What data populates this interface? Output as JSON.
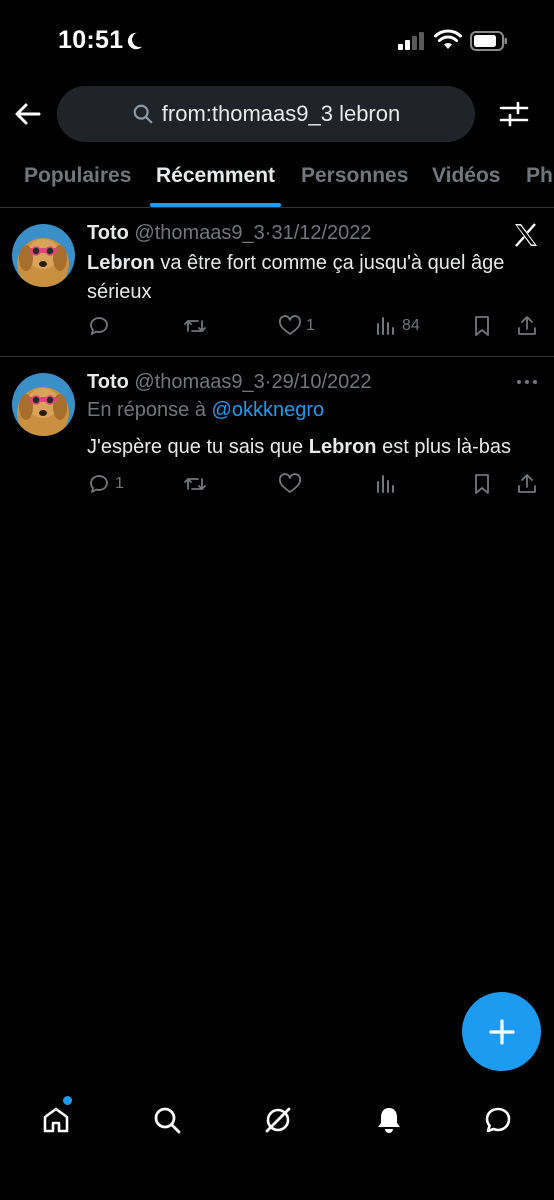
{
  "status_bar": {
    "time": "10:51"
  },
  "search": {
    "query": "from:thomaas9_3 lebron"
  },
  "tabs": [
    {
      "label": "Populaires"
    },
    {
      "label": "Récemment"
    },
    {
      "label": "Personnes"
    },
    {
      "label": "Vidéos"
    },
    {
      "label": "Ph"
    }
  ],
  "tweets": [
    {
      "name": "Toto",
      "handle": "@thomaas9_3",
      "dot": "·",
      "date": "31/12/2022",
      "reply_prefix": "",
      "reply_handle": "",
      "text_bold": "Lebron",
      "text_rest": " va être fort comme ça jusqu'à quel âge sérieux",
      "text_before": "",
      "replies": "",
      "likes": "1",
      "views": "84"
    },
    {
      "name": "Toto",
      "handle": "@thomaas9_3",
      "dot": "·",
      "date": "29/10/2022",
      "reply_prefix": "En réponse à ",
      "reply_handle": "@okkknegro",
      "text_before": "J'espère que tu sais que ",
      "text_bold": "Lebron",
      "text_rest": " est plus là-bas",
      "replies": "1",
      "likes": "",
      "views": ""
    }
  ],
  "colors": {
    "accent": "#1d9bf0",
    "muted": "#71767b",
    "background": "#000000",
    "search_bg": "#202327"
  },
  "icons": {
    "nav": [
      "home-icon",
      "search-icon",
      "grok-icon",
      "notifications-icon",
      "messages-icon"
    ],
    "fab": "compose-plus-icon"
  }
}
